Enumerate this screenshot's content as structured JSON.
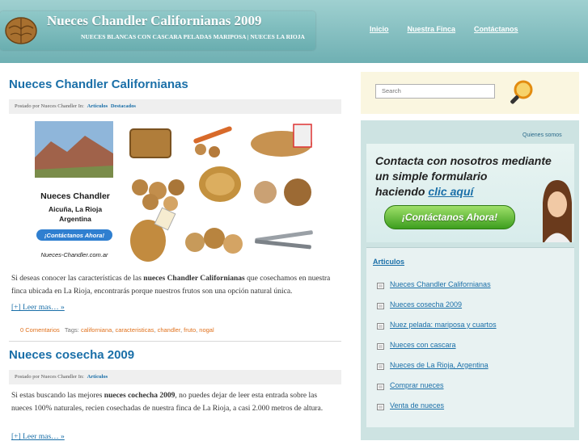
{
  "header": {
    "title": "Nueces Chandler Californianas 2009",
    "tagline": "NUECES BLANCAS CON CASCARA PELADAS MARIPOSA | NUECES LA RIOJA",
    "nav": [
      "Inicio",
      "Nuestra Finca",
      "Contáctanos"
    ]
  },
  "posts": [
    {
      "title": "Nueces Chandler Californianas",
      "meta_prefix": "Postado por Nueces Chandler In:",
      "categories": [
        "Articulos",
        "Destacados"
      ],
      "collage": {
        "brand": "Nueces Chandler",
        "location1": "Aicuña, La Rioja",
        "location2": "Argentina",
        "cta": "¡Contáctanos Ahora!",
        "url": "Nueces-Chandler.com.ar"
      },
      "body_pre": "Si deseas conocer las características de las ",
      "body_bold": "nueces Chandler Californianas",
      "body_post": " que cosechamos en nuestra finca ubicada en La Rioja, encontrarás porque nuestros frutos son una opción natural única.",
      "read_more": "[+] Leer mas… »",
      "comments": "0 Comentarios",
      "tags_label": "Tags:",
      "tags": [
        "californiana",
        "caracteristicas",
        "chandler",
        "fruto",
        "nogal"
      ]
    },
    {
      "title": "Nueces cosecha 2009",
      "meta_prefix": "Postado por Nueces Chandler In:",
      "categories": [
        "Articulos"
      ],
      "body_pre": "Si estas buscando las mejores ",
      "body_bold": "nueces cochecha 2009",
      "body_post": ", no puedes dejar de leer esta entrada sobre las nueces 100% naturales, recien cosechadas de nuestra finca de La Rioja, a casi 2.000 metros de altura.",
      "read_more": "[+] Leer mas… »"
    }
  ],
  "sidebar": {
    "search_placeholder": "Search",
    "quienes": "Quienes somos",
    "ad": {
      "line1": "Contacta con nosotros mediante",
      "line2": "un simple formulario",
      "line3_pre": "haciendo ",
      "line3_link": "clic aquí",
      "button": "¡Contáctanos Ahora!"
    },
    "categories_title": "Articulos",
    "categories": [
      "Nueces Chandler Californianas",
      "Nueces cosecha 2009",
      "Nuez pelada: mariposa y cuartos",
      "Nueces con cascara",
      "Nueces de La Rioja, Argentina",
      "Comprar nueces",
      "Venta de nueces"
    ]
  },
  "colors": {
    "header_teal": "#6fb0b3",
    "link_blue": "#1a6fa8",
    "tag_orange": "#e0711c",
    "sidebar_bg": "#cde3e2",
    "search_bg": "#faf6e0"
  }
}
